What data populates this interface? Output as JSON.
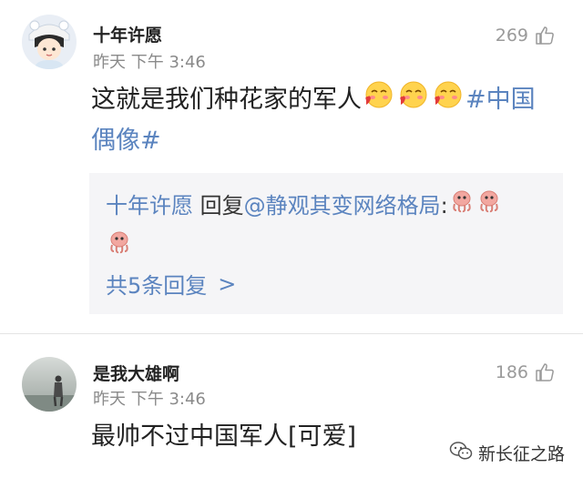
{
  "comments": [
    {
      "username": "十年许愿",
      "time": "昨天 下午 3:46",
      "likes": "269",
      "content_text": "这就是我们种花家的军人",
      "content_topic_1": "#中国",
      "content_topic_2": "偶像#",
      "emoji_names": [
        "blush-kiss-emoji",
        "blush-kiss-emoji",
        "blush-kiss-emoji"
      ],
      "reply": {
        "author": "十年许愿",
        "verb": " 回复",
        "mention": "@静观其变网络格局",
        "colon": ":",
        "more_label": "共5条回复",
        "more_arrow": ">"
      }
    },
    {
      "username": "是我大雄啊",
      "time": "昨天 下午 3:46",
      "likes": "186",
      "content_text": "最帅不过中国军人[可爱]"
    }
  ],
  "watermark": {
    "label": "新长征之路"
  },
  "colors": {
    "link": "#5b84bf",
    "muted": "#8a8a8a",
    "reply_bg": "#f5f5f7"
  },
  "icons": [
    "thumbs-up-icon",
    "chevron-right-icon",
    "wechat-icon"
  ]
}
